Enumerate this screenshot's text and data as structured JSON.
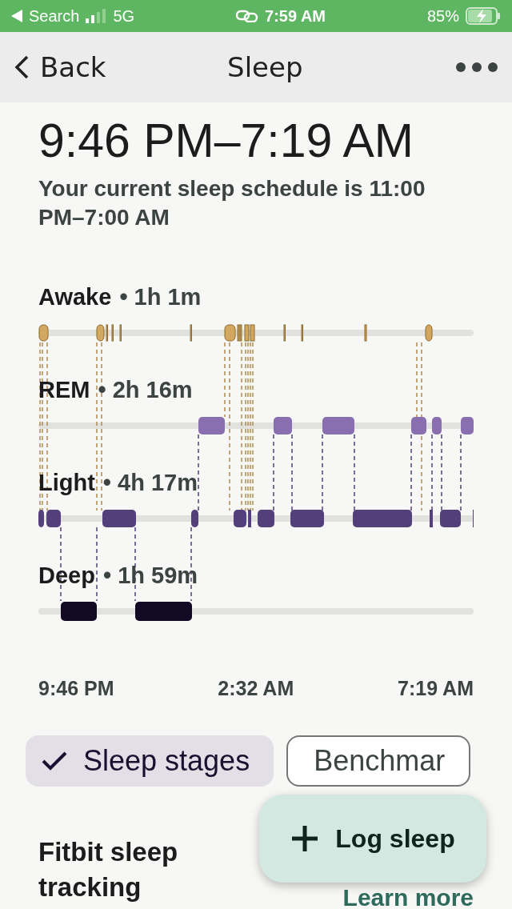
{
  "status_bar": {
    "back_label": "Search",
    "network": "5G",
    "time": "7:59 AM",
    "battery": "85%"
  },
  "nav": {
    "back": "Back",
    "title": "Sleep"
  },
  "sleep_range": "9:46 PM–7:19 AM",
  "schedule": "Your current sleep schedule is 11:00 PM–7:00 AM",
  "stages": [
    {
      "name": "Awake",
      "duration": "• 1h 1m"
    },
    {
      "name": "REM",
      "duration": "• 2h 16m"
    },
    {
      "name": "Light",
      "duration": "• 4h 17m"
    },
    {
      "name": "Deep",
      "duration": "• 1h 59m"
    }
  ],
  "time_axis": [
    "9:46 PM",
    "2:32 AM",
    "7:19 AM"
  ],
  "chips": [
    {
      "label": "Sleep stages",
      "selected": true
    },
    {
      "label": "Benchmar",
      "selected": false
    }
  ],
  "section": {
    "title": "Fitbit sleep tracking",
    "link": "Learn more"
  },
  "fab": {
    "label": "Log sleep"
  }
}
